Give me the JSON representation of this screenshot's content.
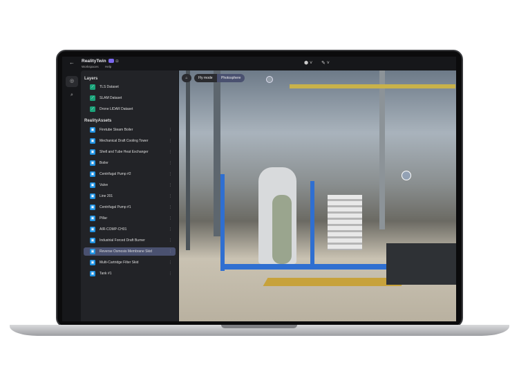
{
  "app": {
    "title": "RealityTwin",
    "nav": [
      "Workspaces",
      "Help"
    ]
  },
  "toolbar": {
    "view_icon": "cube-view-icon",
    "draw_icon": "pen-icon"
  },
  "rail": [
    "layers-icon",
    "search-icon"
  ],
  "layers": {
    "heading": "Layers",
    "items": [
      "TLS Dataset",
      "SLAM Dataset",
      "Drone LIDAR Dataset"
    ]
  },
  "assets": {
    "heading": "RealityAssets",
    "items": [
      "Firetube Steam Boiler",
      "Mechanical Draft Cooling Tower",
      "Shell and Tube Heat Exchanger",
      "Boiler",
      "Centrifugal Pump #2",
      "Valve",
      "Line 201",
      "Centrifugal Pump #1",
      "Pillar",
      "AIR-COMP-CH01",
      "Industrial Forced Draft Burner",
      "Reverse Osmosis Membrane Skid",
      "Multi-Cartridge Filter Skid",
      "Tank #1"
    ],
    "selected": "Reverse Osmosis Membrane Skid"
  },
  "viewport": {
    "modes": [
      "Fly mode",
      "Photosphere"
    ],
    "active_mode": "Photosphere"
  }
}
